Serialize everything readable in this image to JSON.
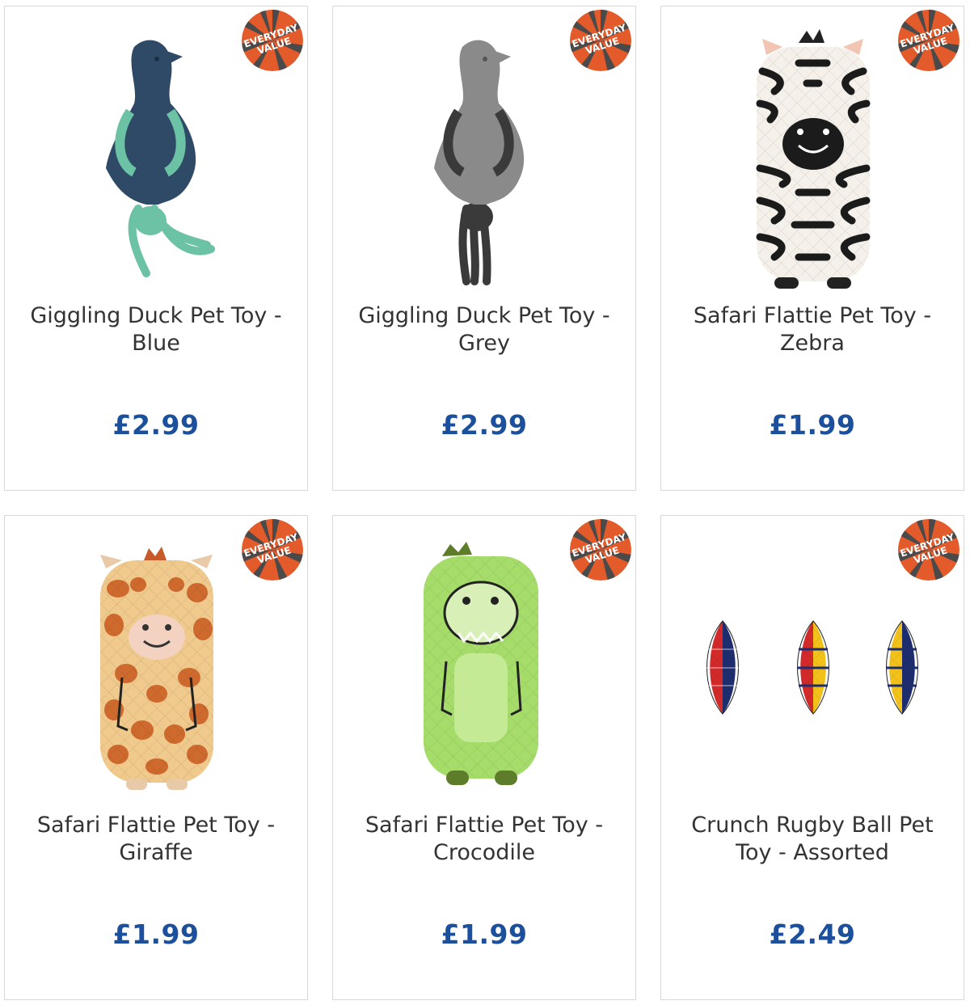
{
  "badge": {
    "line1": "EVERYDAY",
    "line2": "VALUE"
  },
  "colors": {
    "price": "#1c4f9c",
    "badge_orange": "#e35a2b",
    "badge_dark": "#4a4a4a"
  },
  "products": [
    {
      "name": "Giggling Duck Pet Toy - Blue",
      "price": "£2.99",
      "image": "blue-duck-rope-toy-icon"
    },
    {
      "name": "Giggling Duck Pet Toy - Grey",
      "price": "£2.99",
      "image": "grey-duck-rope-toy-icon"
    },
    {
      "name": "Safari Flattie Pet Toy - Zebra",
      "price": "£1.99",
      "image": "zebra-plush-toy-icon"
    },
    {
      "name": "Safari Flattie Pet Toy - Giraffe",
      "price": "£1.99",
      "image": "giraffe-plush-toy-icon"
    },
    {
      "name": "Safari Flattie Pet Toy - Crocodile",
      "price": "£1.99",
      "image": "crocodile-plush-toy-icon"
    },
    {
      "name": "Crunch Rugby Ball Pet Toy - Assorted",
      "price": "£2.49",
      "image": "rugby-ball-toys-icon"
    }
  ]
}
